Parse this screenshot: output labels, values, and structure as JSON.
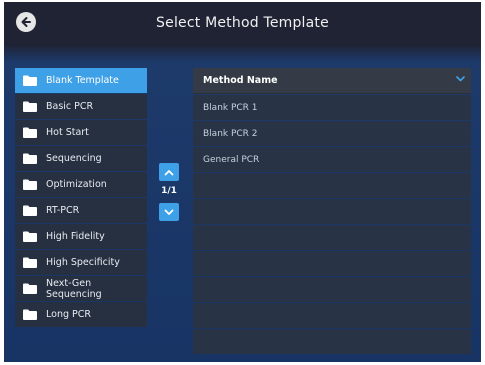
{
  "header": {
    "title": "Select Method Template",
    "back_icon": "back-arrow-icon"
  },
  "categories": [
    {
      "label": "Blank Template",
      "selected": true
    },
    {
      "label": "Basic PCR",
      "selected": false
    },
    {
      "label": "Hot Start",
      "selected": false
    },
    {
      "label": "Sequencing",
      "selected": false
    },
    {
      "label": "Optimization",
      "selected": false
    },
    {
      "label": "RT-PCR",
      "selected": false
    },
    {
      "label": "High Fidelity",
      "selected": false
    },
    {
      "label": "High Specificity",
      "selected": false
    },
    {
      "label": "Next-Gen Sequencing",
      "selected": false
    },
    {
      "label": "Long PCR",
      "selected": false
    }
  ],
  "pager": {
    "text": "1/1",
    "up_icon": "chevron-up-icon",
    "down_icon": "chevron-down-icon"
  },
  "table": {
    "header": "Method Name",
    "sort_icon": "chevron-down-icon",
    "rows": [
      "Blank PCR 1",
      "Blank PCR 2",
      "General PCR",
      "",
      "",
      "",
      "",
      "",
      "",
      ""
    ]
  },
  "colors": {
    "accent": "#3ea0e6",
    "item_bg": "#273040",
    "title_bar": "#1f2333",
    "background": "#173465"
  }
}
